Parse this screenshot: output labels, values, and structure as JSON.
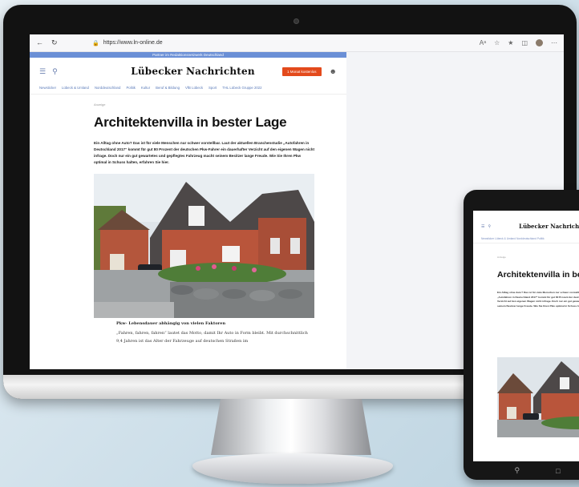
{
  "browser": {
    "url": "https://www.ln-online.de",
    "nav_icons": [
      "back-icon",
      "reload-icon"
    ]
  },
  "site": {
    "promo_banner": "Partner im Redaktionsnetzwerk Deutschland",
    "logo": "Lübecker Nachrichten",
    "subscribe_label": "1 Monat kostenlos",
    "categories": [
      "Newsticker",
      "Lübeck & Umland",
      "Norddeutschland",
      "Politik",
      "Kultur",
      "Beruf & Bildung",
      "VfB Lübeck",
      "Sport",
      "THL Lübeck Gruppe 2022"
    ]
  },
  "article": {
    "kicker": "Anzeige",
    "headline": "Architektenvilla in bester Lage",
    "lead": "Ein Alltag ohne Auto? Das ist für viele Menschen nur schwer vorstellbar. Laut der aktuellen Branchenstudie „Autofahren in Deutschland 2017“ kommt für gut 80 Prozent der deutschen Pkw-Fahrer ein dauerhafter Verzicht auf den eigenen Wagen nicht infrage. Doch nur ein gut gewartetes und gepflegtes Fahrzeug macht seinem Besitzer lange Freude. Wie Sie Ihren Pkw optimal in Schuss halten, erfahren Sie hier.",
    "caption": "Pkw- Lebensdauer abhängig von vielen Faktoren",
    "body": "„Fahren, fahren, fahren“ lautet das Motto, damit Ihr Auto in Form bleibt. Mit durchschnittlich 9,4 Jahren ist das Alter der Fahrzeuge auf deutschen Straßen im"
  },
  "tablet": {
    "logo": "Lübecker Nachrichten",
    "categories": "Newsticker   Lübeck & Umland   Norddeutschland   Politik",
    "kicker": "Anzeige",
    "headline": "Architektenvilla in bester Lage",
    "lead": "Ein Alltag ohne Auto? Das ist für viele Menschen nur schwer vorstellbar. Laut der aktuellen Branchenstudie „Autofahren in Deutschland 2017“ kommt für gut 80 Prozent der deutschen Pkw-Fahrer ein dauerhafter Verzicht auf den eigenen Wagen nicht infrage. Doch nur ein gut gewartetes und gepflegtes Fahrzeug macht seinem Besitzer lange Freude. Wie Sie Ihren Pkw optimal in Schuss halten, erfahren Sie hier."
  },
  "colors": {
    "accent": "#e34a1c",
    "nav_link": "#5b7bb9",
    "promo": "#6a8fd6"
  }
}
